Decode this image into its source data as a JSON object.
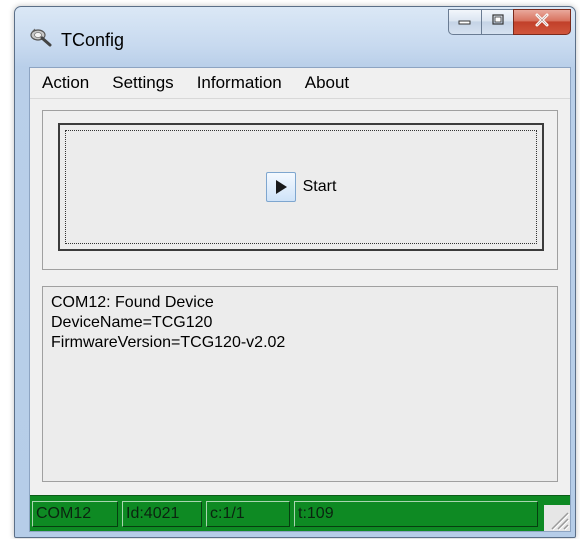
{
  "window": {
    "title": "TConfig"
  },
  "menu": {
    "items": [
      {
        "label": "Action"
      },
      {
        "label": "Settings"
      },
      {
        "label": "Information"
      },
      {
        "label": "About"
      }
    ]
  },
  "main": {
    "start_label": "Start",
    "start_icon": "play-icon",
    "log_lines": [
      "COM12: Found Device",
      "DeviceName=TCG120",
      "FirmwareVersion=TCG120-v2.02"
    ]
  },
  "status": {
    "port": "COM12",
    "id": "Id:4021",
    "c": "c:1/1",
    "t": "t:109",
    "color": "#0e8a23"
  },
  "icons": {
    "app": "magnifier-app-icon",
    "minimize": "minimize-icon",
    "maximize": "maximize-icon",
    "close": "close-icon",
    "grip": "resize-grip-icon"
  }
}
